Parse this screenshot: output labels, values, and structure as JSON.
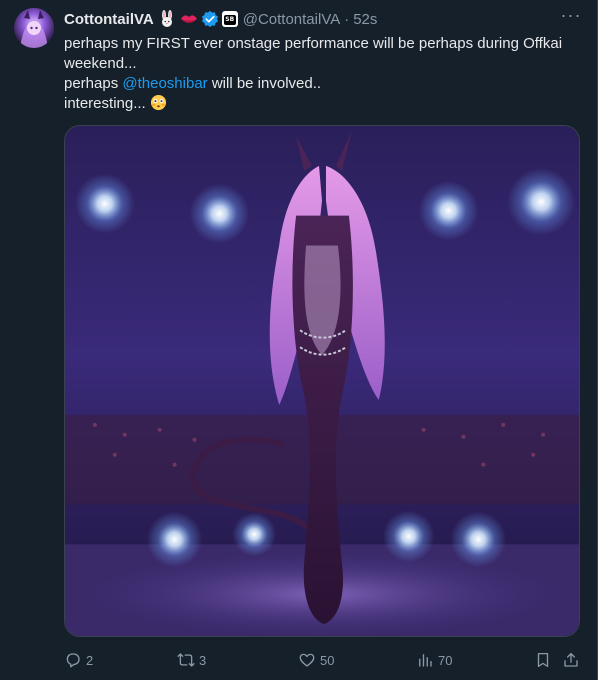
{
  "author": {
    "name": "CottontailVA",
    "handle": "@CottontailVA",
    "separator": "·",
    "time": "52s",
    "emojis": [
      "rabbit-emoji",
      "kiss-mark-emoji"
    ],
    "verified_color": "#1d9bf0"
  },
  "tweet": {
    "line1": "perhaps my FIRST ever onstage performance will be perhaps during Offkai weekend...",
    "line2_prefix": "perhaps ",
    "mention": "@theoshibar",
    "line2_suffix": " will be involved..",
    "line3": "interesting... ",
    "line3_emoji": "flushed-face-emoji"
  },
  "actions": {
    "reply_count": "2",
    "retweet_count": "3",
    "like_count": "50",
    "view_count": "70"
  },
  "colors": {
    "background": "#15202b",
    "text": "#e7e9ea",
    "muted": "#8b98a5",
    "accent": "#1d9bf0",
    "border": "#38444d"
  }
}
